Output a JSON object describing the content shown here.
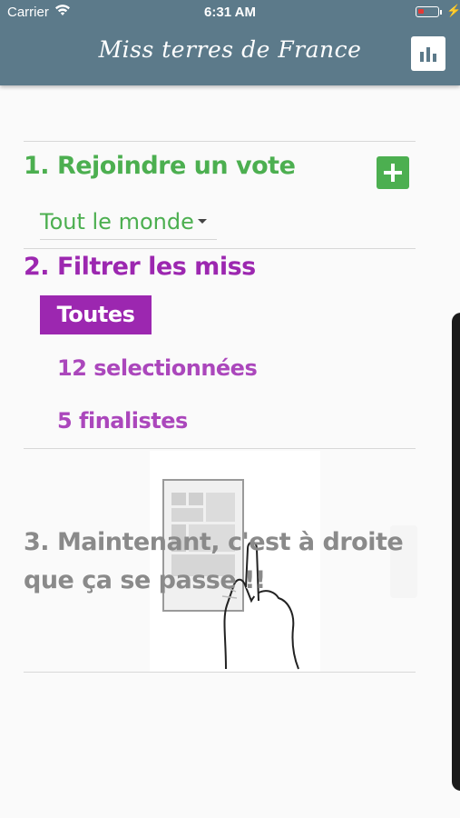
{
  "status_bar": {
    "carrier": "Carrier",
    "time": "6:31 AM"
  },
  "header": {
    "title": "Miss terres de France",
    "stats_icon": "bar-chart-icon"
  },
  "section1": {
    "title": "1. Rejoindre un vote",
    "add_icon": "plus-icon",
    "select_value": "Tout le monde"
  },
  "section2": {
    "title": "2. Filtrer les miss",
    "options": [
      {
        "label": "Toutes",
        "active": true
      },
      {
        "label": "12 selectionnées",
        "active": false
      },
      {
        "label": "5 finalistes",
        "active": false
      }
    ]
  },
  "section3": {
    "line1": "3. Maintenant, c'est à droite",
    "line2": "que ça se passe !!"
  },
  "colors": {
    "header_bg": "#5c7a8a",
    "green": "#4caf50",
    "purple": "#9c27b0",
    "gray_text": "#8a8a8a"
  }
}
